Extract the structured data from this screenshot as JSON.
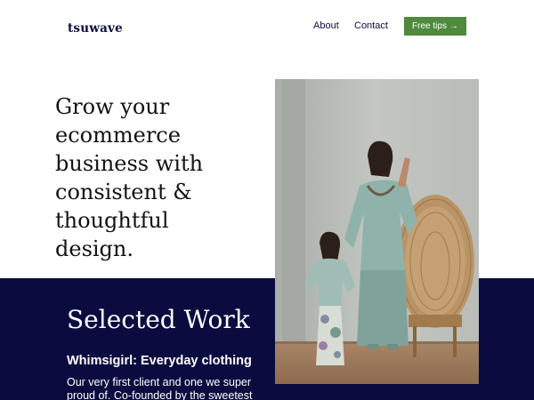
{
  "header": {
    "logo": "tsuwave",
    "nav": {
      "about": "About",
      "contact": "Contact"
    },
    "cta": {
      "label": "Free tips",
      "arrow": "→"
    }
  },
  "hero": {
    "headline": "Grow your ecommerce business with consistent & thoughtful design."
  },
  "work": {
    "section_title": "Selected Work",
    "item_title": "Whimsigirl: Everyday clothing",
    "item_description": "Our very first client and one we super proud of. Co-founded by the sweetest"
  },
  "colors": {
    "navy": "#0a0c3f",
    "cta_green": "#4f8a3c",
    "text_dark": "#0b0f3d"
  },
  "icons": {
    "cta_arrow": "arrow-right-icon"
  }
}
